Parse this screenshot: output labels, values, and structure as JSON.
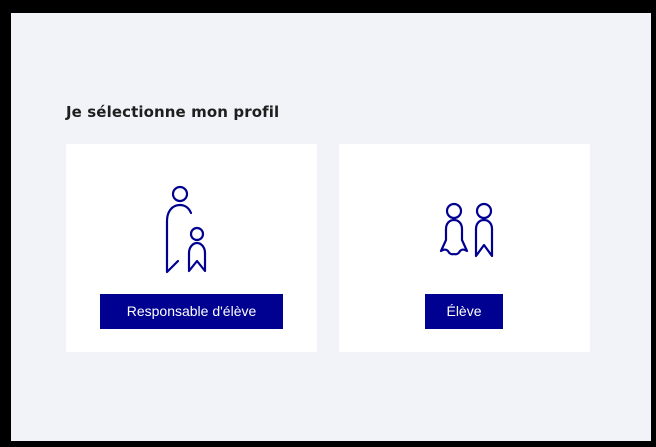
{
  "page": {
    "title": "Je sélectionne mon profil"
  },
  "profiles": [
    {
      "label": "Responsable d'élève",
      "icon": "parent-child-icon"
    },
    {
      "label": "Élève",
      "icon": "students-icon"
    }
  ],
  "colors": {
    "accent": "#000091",
    "page_background": "#f2f3f8",
    "card_background": "#ffffff",
    "frame_border": "#000000",
    "title_text": "#1e1e1e"
  }
}
